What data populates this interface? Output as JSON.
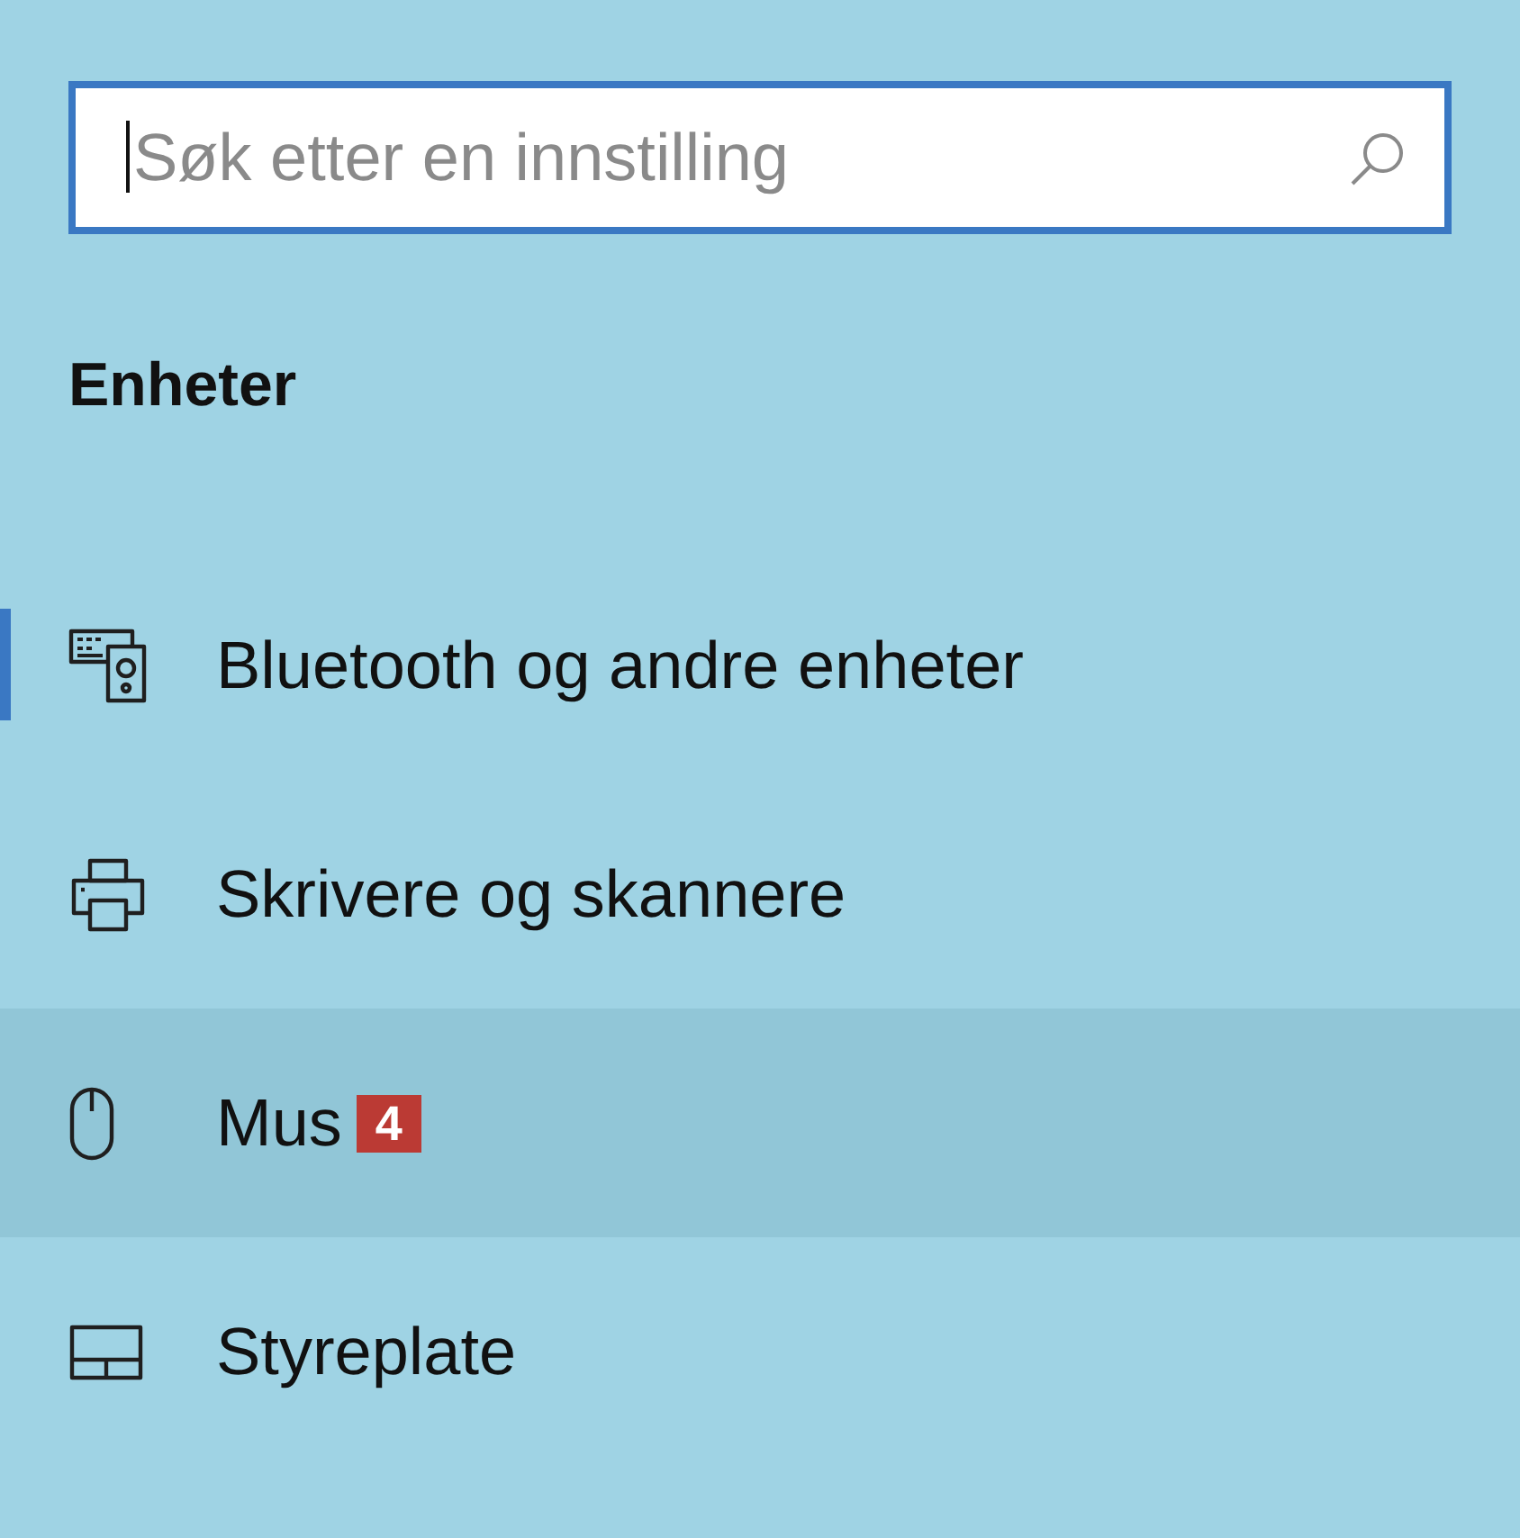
{
  "search": {
    "placeholder": "Søk etter en innstilling",
    "focused": true
  },
  "section": {
    "title": "Enheter"
  },
  "nav": {
    "items": [
      {
        "label": "Bluetooth og andre enheter",
        "kind": "devices",
        "selected": true,
        "hovered": false
      },
      {
        "label": "Skrivere og skannere",
        "kind": "printer",
        "selected": false,
        "hovered": false
      },
      {
        "label": "Mus",
        "kind": "mouse",
        "selected": false,
        "hovered": true,
        "badge": "4"
      },
      {
        "label": "Styreplate",
        "kind": "touchpad",
        "selected": false,
        "hovered": false
      }
    ]
  }
}
